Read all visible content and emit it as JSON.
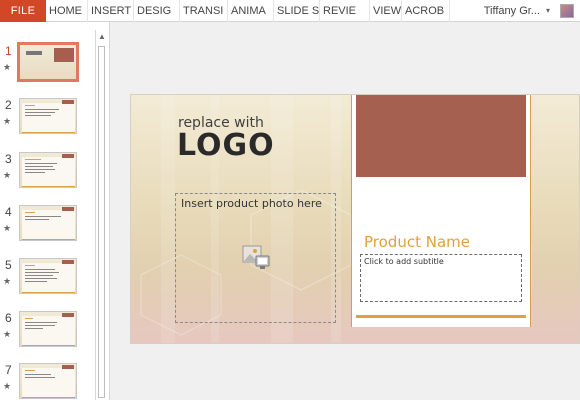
{
  "ribbon": {
    "file_label": "FILE",
    "tabs": [
      "HOME",
      "INSERT",
      "DESIG",
      "TRANSI",
      "ANIMA",
      "SLIDE S",
      "REVIE",
      "VIEW",
      "ACROB"
    ],
    "user_name": "Tiffany Gr..."
  },
  "thumbnails": [
    {
      "number": "1",
      "star": "★",
      "active": true
    },
    {
      "number": "2",
      "star": "★"
    },
    {
      "number": "3",
      "star": "★"
    },
    {
      "number": "4",
      "star": "★"
    },
    {
      "number": "5",
      "star": "★"
    },
    {
      "number": "6",
      "star": "★"
    },
    {
      "number": "7",
      "star": "★"
    }
  ],
  "slide": {
    "logo_small": "replace with",
    "logo_big": "LOGO",
    "photo_placeholder": "Insert product photo here",
    "product_name": "Product Name",
    "subtitle_placeholder": "Click to add subtitle"
  },
  "colors": {
    "accent": "#d24726",
    "brand_brown": "#a5604f",
    "gold": "#e0a040"
  }
}
